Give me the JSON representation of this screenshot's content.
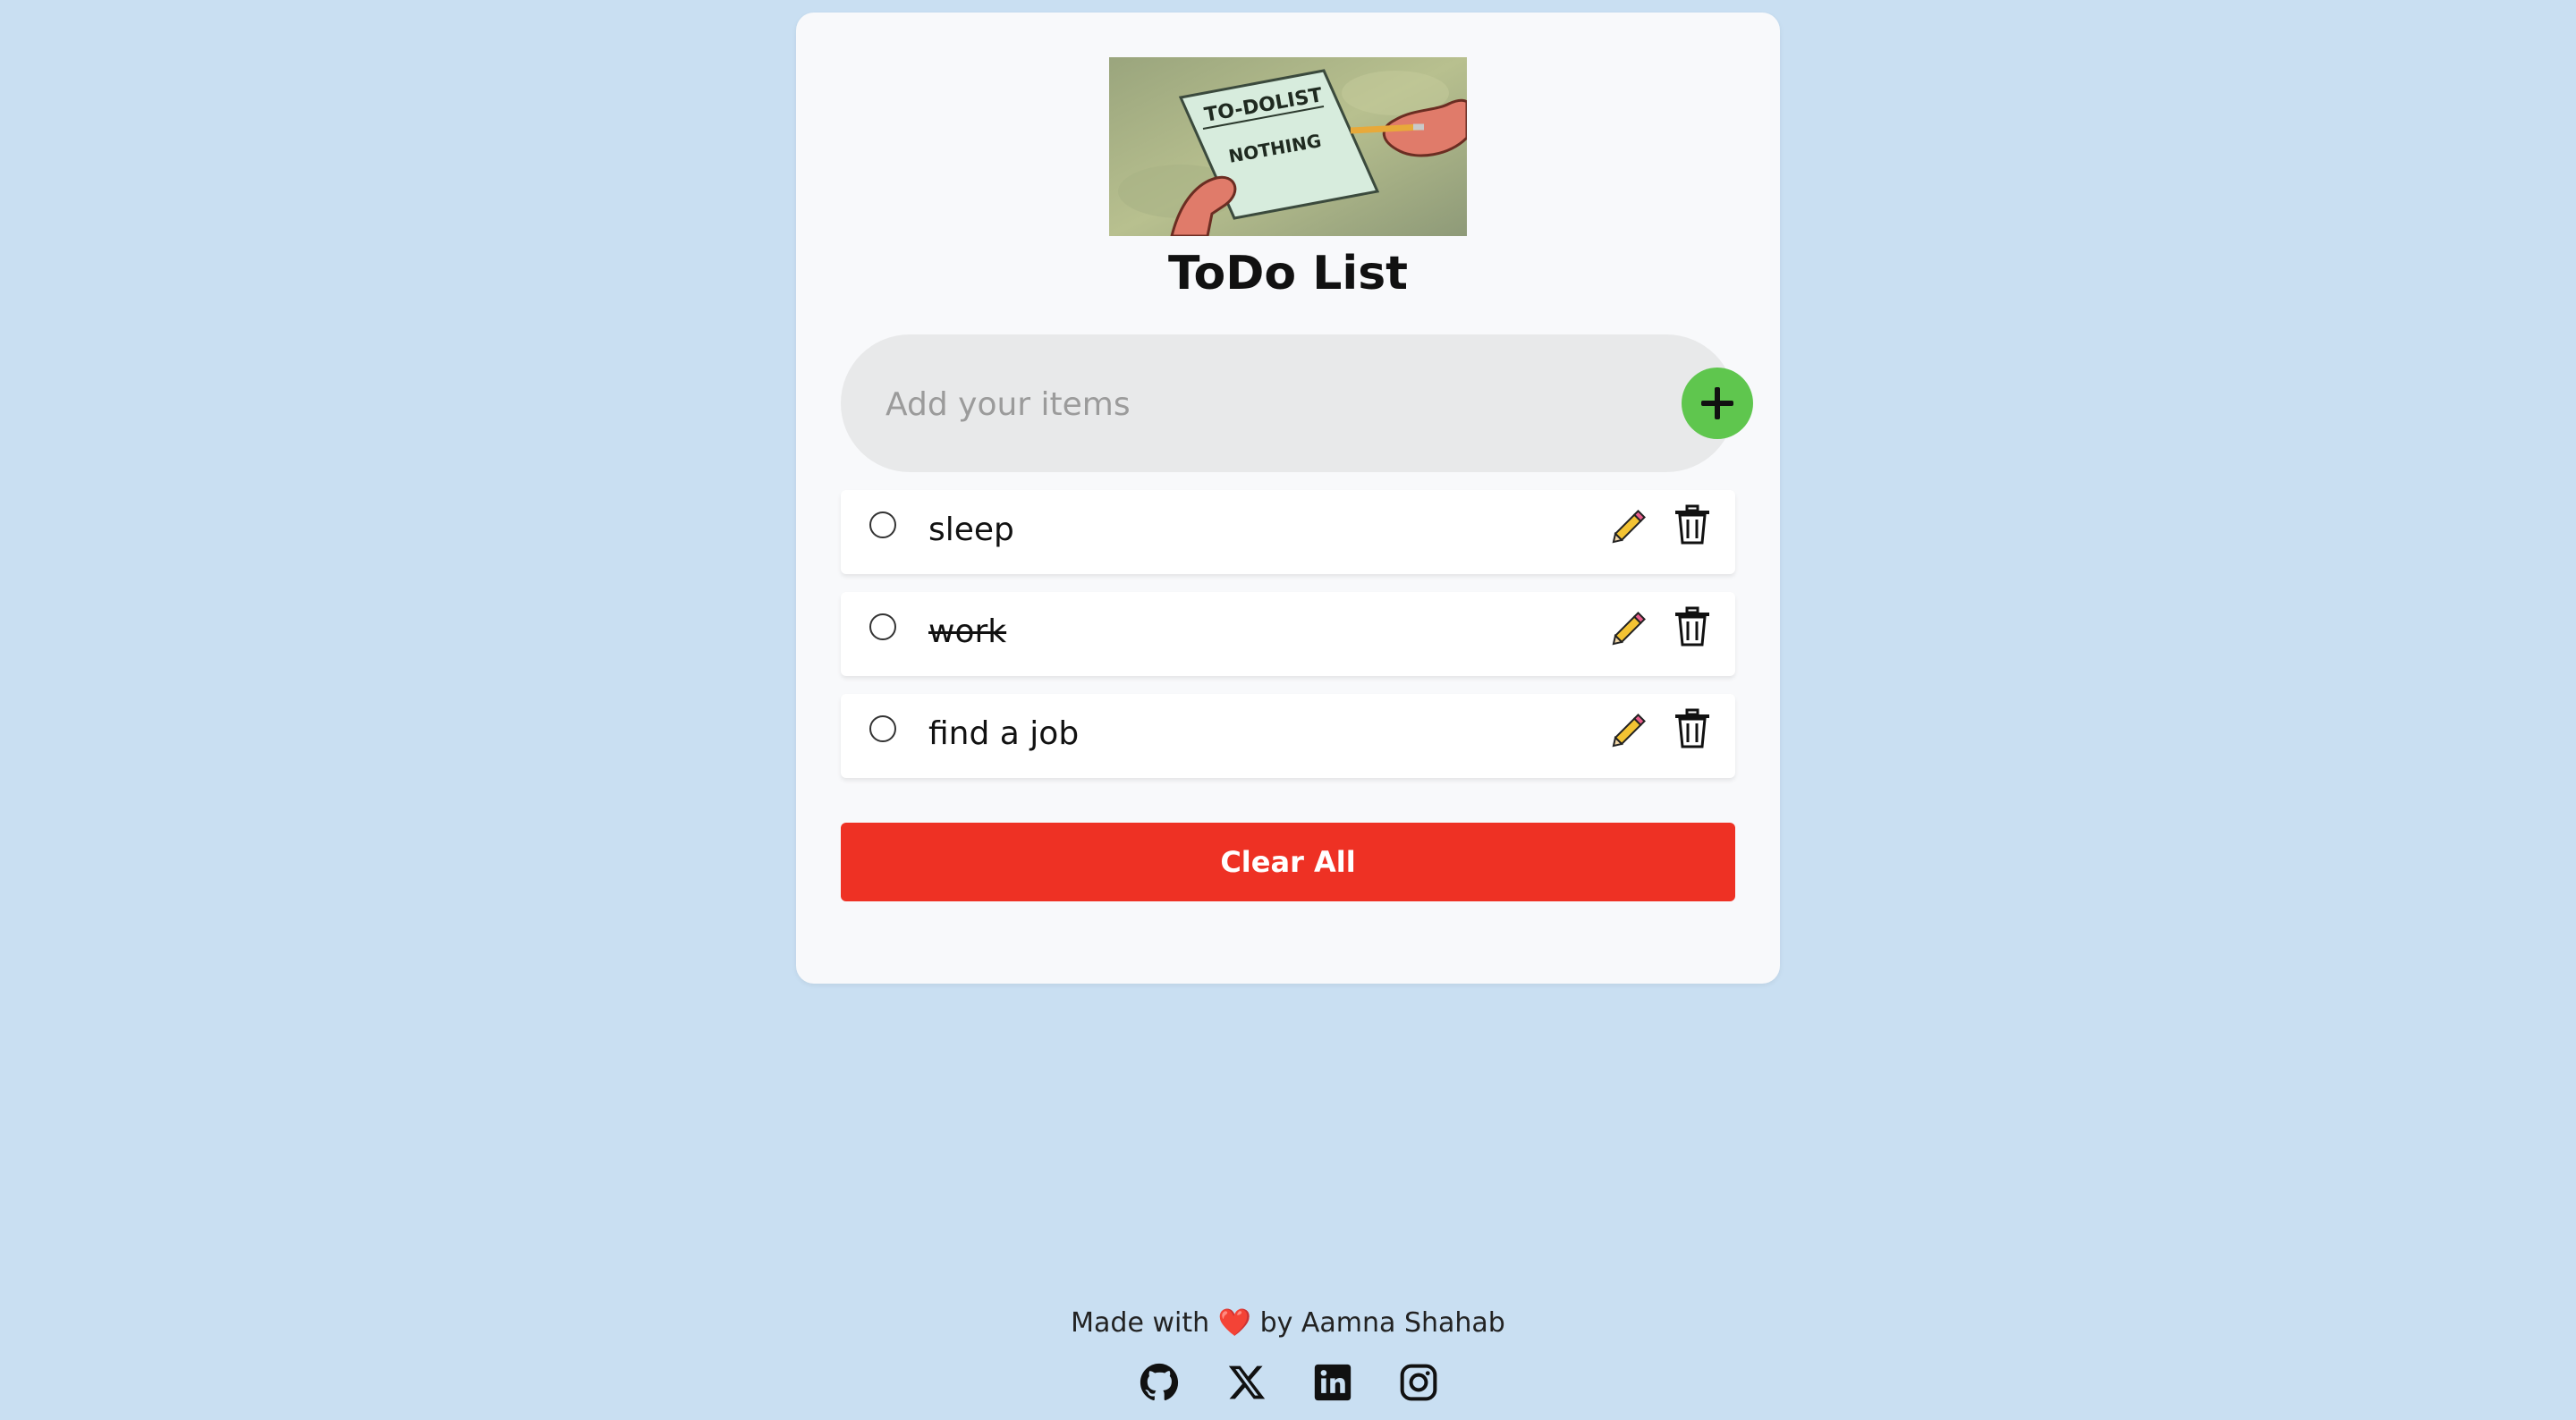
{
  "header": {
    "title": "ToDo List",
    "meme_text_line1": "TO-DOLIST",
    "meme_text_line2": "NOTHING"
  },
  "input": {
    "placeholder": "Add your items",
    "value": "",
    "add_icon": "plus-icon"
  },
  "todos": [
    {
      "text": "sleep",
      "completed": false
    },
    {
      "text": "work",
      "completed": true
    },
    {
      "text": "find a job",
      "completed": false
    }
  ],
  "actions": {
    "edit_icon": "pencil-icon",
    "delete_icon": "trash-icon",
    "clear_label": "Clear All"
  },
  "footer": {
    "prefix": "Made with",
    "heart": "❤️",
    "suffix": "by Aamna Shahab",
    "socials": [
      "github-icon",
      "x-icon",
      "linkedin-icon",
      "instagram-icon"
    ]
  },
  "colors": {
    "background": "#c9dff2",
    "card": "#f8f9fb",
    "add_button": "#5fc64e",
    "clear_button": "#ee3124"
  }
}
